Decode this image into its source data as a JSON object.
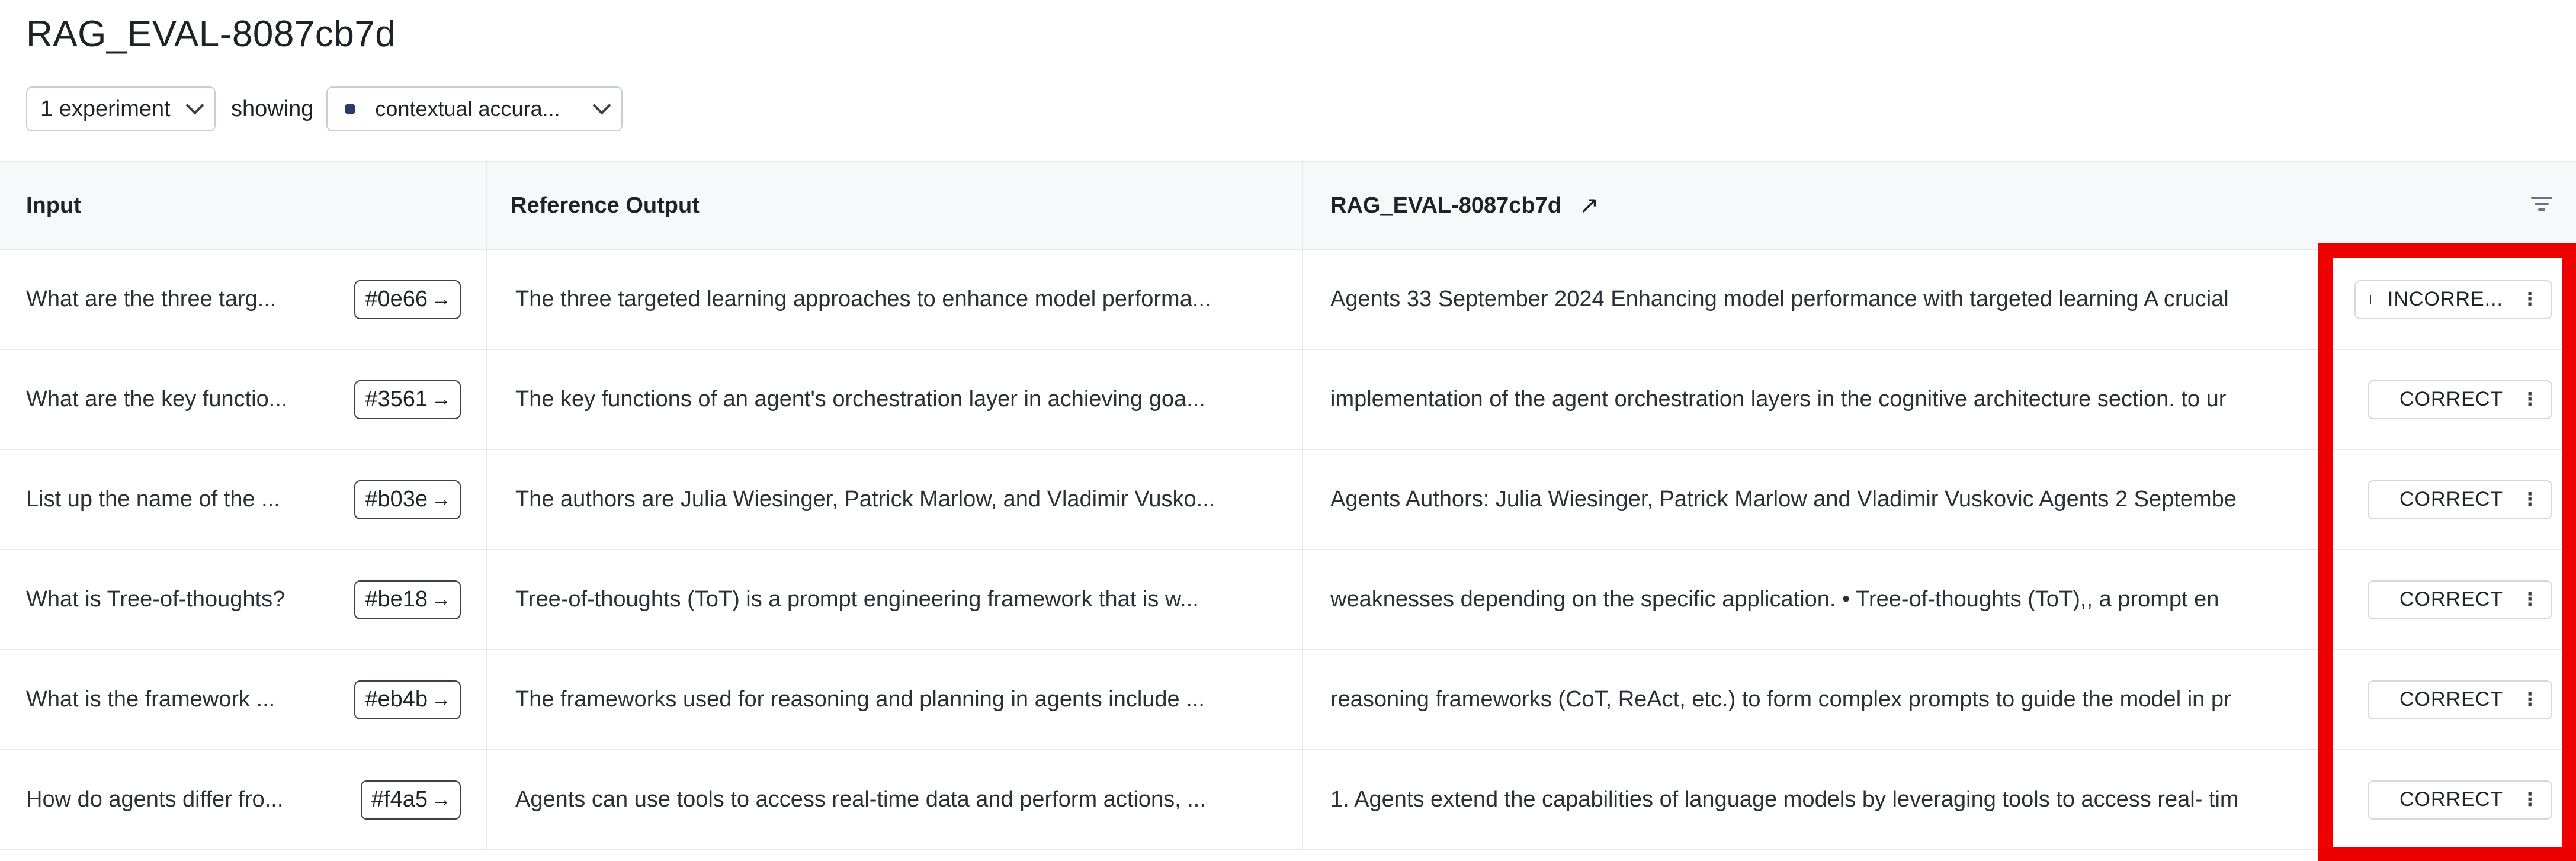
{
  "page": {
    "title": "RAG_EVAL-8087cb7d"
  },
  "toolbar": {
    "experiments_label": "1 experiment",
    "showing_label": "showing",
    "metric_label": "contextual accura...",
    "metric_color": "#2b3a67"
  },
  "table": {
    "headers": {
      "input": "Input",
      "reference": "Reference Output",
      "experiment": "RAG_EVAL-8087cb7d"
    },
    "rows": [
      {
        "input": "What are the three targ...",
        "id": "#0e66",
        "reference": "The three targeted learning approaches to enhance model performa...",
        "output": "Agents 33 September 2024 Enhancing model performance with targeted learning A crucial",
        "grade": "INCORRE..."
      },
      {
        "input": "What are the key functio...",
        "id": "#3561",
        "reference": "The key functions of an agent's orchestration layer in achieving goa...",
        "output": "implementation of the agent orchestration layers in the cognitive architecture section. to ur",
        "grade": "CORRECT"
      },
      {
        "input": "List up the name of the ...",
        "id": "#b03e",
        "reference": "The authors are Julia Wiesinger, Patrick Marlow, and Vladimir Vusko...",
        "output": "Agents Authors: Julia Wiesinger, Patrick Marlow and Vladimir Vuskovic Agents 2 Septembe",
        "grade": "CORRECT"
      },
      {
        "input": "What is Tree-of-thoughts?",
        "id": "#be18",
        "reference": "Tree-of-thoughts (ToT) is a prompt engineering framework that is w...",
        "output": "weaknesses depending on the specific application. • Tree-of-thoughts (ToT),, a prompt en",
        "grade": "CORRECT"
      },
      {
        "input": "What is the framework ...",
        "id": "#eb4b",
        "reference": "The frameworks used for reasoning and planning in agents include ...",
        "output": "reasoning frameworks (CoT, ReAct, etc.) to form complex prompts to guide the model in pr",
        "grade": "CORRECT"
      },
      {
        "input": "How do agents differ fro...",
        "id": "#f4a5",
        "reference": "Agents can use tools to access real-time data and perform actions, ...",
        "output": "1. Agents extend the capabilities of language models by leveraging tools to access real- tim",
        "grade": "CORRECT"
      }
    ]
  },
  "icons": {
    "external_link": "↗",
    "tag_arrow": "→",
    "badge_menu": "⋮"
  },
  "highlight_color": "#ee0000"
}
